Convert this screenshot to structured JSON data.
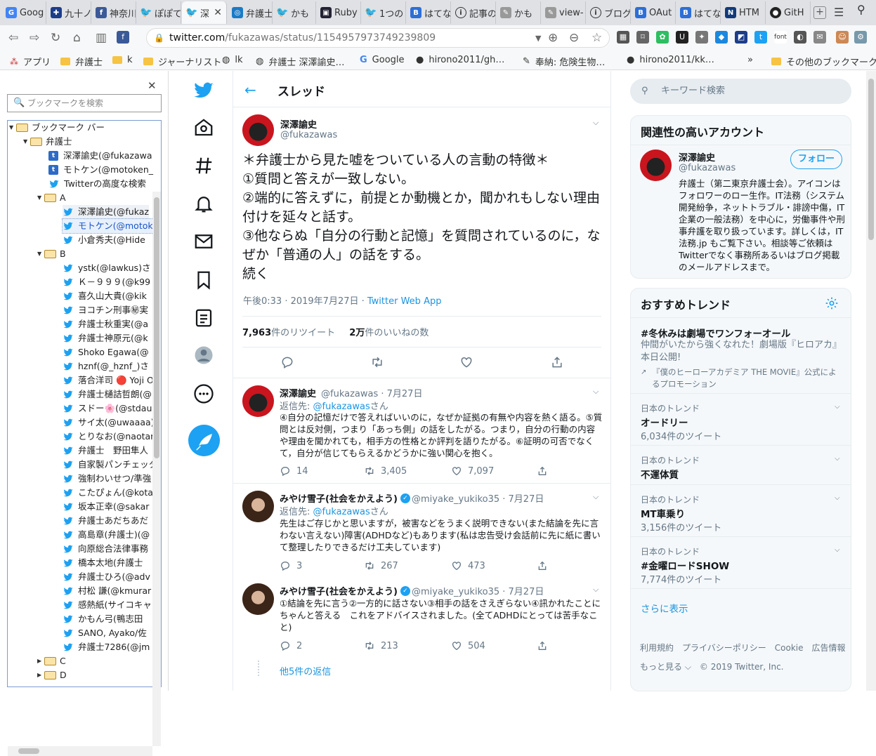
{
  "browser": {
    "tabs": [
      "Goog",
      "九十ノ",
      "神奈川",
      "ぽぽて",
      "深",
      "弁護士",
      "かも",
      "Ruby",
      "1つの",
      "はてな",
      "記事の",
      "かも",
      "view-",
      "ブログ",
      "OAut",
      "はてな",
      "HTM",
      "GitH"
    ],
    "url_host": "twitter.com",
    "url_path": "/fukazawas/status/1154957973749239809"
  },
  "bookmarks_bar": [
    "アプリ",
    "弁護士",
    "k",
    "ジャーナリスト",
    "lk",
    "弁護士 深澤諭史…",
    "Google",
    "hirono2011/gh…",
    "奉納: 危険生物…",
    "hirono2011/kk…",
    "その他のブックマーク"
  ],
  "sidebar": {
    "search_placeholder": "ブックマークを検索",
    "tree": {
      "root": "ブックマーク バー",
      "f1": "弁護士",
      "i1": "深澤諭史(@fukazawa",
      "i2": "モトケン(@motoken_",
      "i3": "Twitterの高度な検索",
      "fA": "A",
      "a1": "深澤諭史(@fukaz",
      "a2": "モトケン(@motok",
      "a3": "小倉秀夫(@Hide",
      "fB": "B",
      "b": [
        "ystk(@lawkus)さ",
        "Ｋ－９９９(@k99",
        "喜久山大貴(@kik",
        "ヨコチン刑事㊙実",
        "弁護士秋重実(@a",
        "弁護士神原元(@k",
        "Shoko Egawa(@",
        "hznf(@_hznf_)さ",
        "落合洋司 🔴 Yoji O",
        "弁護士樋詰哲朗(@",
        "スドー🌸(@stdau",
        "サイ太(@uwaaaa)",
        "とりなお(@naotar",
        "弁護士　野田隼人",
        "自家製パンチェッタ",
        "強制わいせつ/準強",
        "こたぴょん(@kota",
        "坂本正幸(@sakar",
        "弁護士あだちあだ",
        "高島章(弁護士)(@",
        "向原総合法律事務",
        "橋本太地(弁護士",
        "弁護士ひろ(@adv",
        "村松 謙(@kmurar",
        "感熱紙(サイコキャ",
        "かもん弓(鴨志田",
        "SANO, Ayako/佐",
        "弁護士7286(@jm"
      ],
      "fC": "C",
      "fD": "D"
    }
  },
  "main": {
    "header": "スレッド",
    "tweet": {
      "name": "深澤諭史",
      "handle": "@fukazawas",
      "lines": [
        "＊弁護士から見た嘘をついている人の言動の特徴＊",
        "①質問と答えが一致しない。",
        "②端的に答えずに，前提とか動機とか，聞かれもしない理由",
        "付けを延々と話す。",
        "③他ならぬ「自分の行動と記憶」を質問されているのに，な",
        "ぜか「普通の人」の話をする。",
        "続く"
      ],
      "time": "午後0:33 · 2019年7月27日 · ",
      "app": "Twitter Web App",
      "rt_num": "7,963",
      "rt_label": "件のリツイート",
      "like_num": "2万",
      "like_label": "件のいいねの数"
    },
    "replies": [
      {
        "name": "深澤諭史",
        "meta": "@fukazawas · 7月27日",
        "to_prefix": "返信先: ",
        "to": "@fukazawas",
        "to_suffix": "さん",
        "text": "④自分の記憶だけで答えればいいのに，なぜか証拠の有無や内容を熱く語る。⑤質問とは反対側，つまり「あっち側」の話をしたがる。つまり，自分の行動の内容や理由を聞かれても，相手方の性格とか評判を語りたがる。⑥証明の可否でなくて，自分が信じてもらえるかどうかに強い関心を抱く。",
        "replies": "14",
        "retweets": "3,405",
        "likes": "7,097"
      },
      {
        "name": "みやけ雪子(社会をかえよう)",
        "meta": "@miyake_yukiko35 · 7月27日",
        "to_prefix": "返信先: ",
        "to": "@fukazawas",
        "to_suffix": "さん",
        "text": "先生はご存じかと思いますが，被害などをうまく説明できない(また結論を先に言わない言えない)障害(ADHDなど)もあります(私は忠告受け会話前に先に紙に書いて整理したりできるだけ工夫しています)",
        "replies": "3",
        "retweets": "267",
        "likes": "473"
      },
      {
        "name": "みやけ雪子(社会をかえよう)",
        "meta": "@miyake_yukiko35 · 7月27日",
        "text": "①結論を先に言う②一方的に話さない③相手の話をさえぎらない④訊かれたことにちゃんと答える　これをアドバイスされました。(全てADHDにとっては苦手なこと)",
        "replies": "2",
        "retweets": "213",
        "likes": "504"
      }
    ],
    "more_replies": "他5件の返信"
  },
  "right": {
    "search_placeholder": "キーワード検索",
    "related_title": "関連性の高いアカウント",
    "account": {
      "name": "深澤諭史",
      "handle": "@fukazawas",
      "follow": "フォロー",
      "bio": "弁護士（第二東京弁護士会）。アイコンはフォロワーのロー生作。IT法務（システム開発紛争，ネットトラブル・誹謗中傷，IT企業の一般法務）を中心に，労働事件や刑事弁護を取り扱っています。詳しくは，IT法務.jp もご覧下さい。相談等ご依頼はTwitterでなく事務所あるいはブログ掲載のメールアドレスまで。"
    },
    "trends_title": "おすすめトレンド",
    "promo": {
      "name": "#冬休みは劇場でワンフォーオール",
      "desc": "仲間がいたから強くなれた！劇場版『ヒロアカ』本日公開!",
      "by": "『僕のヒーローアカデミア THE MOVIE』公式によるプロモーション"
    },
    "trends": [
      {
        "cat": "日本のトレンド",
        "name": "オードリー",
        "count": "6,034件のツイート"
      },
      {
        "cat": "日本のトレンド",
        "name": "不運体質",
        "count": ""
      },
      {
        "cat": "日本のトレンド",
        "name": "MT車乗り",
        "count": "3,156件のツイート"
      },
      {
        "cat": "日本のトレンド",
        "name": "#金曜ロードSHOW",
        "count": "7,774件のツイート"
      }
    ],
    "show_more": "さらに表示",
    "footer1": "利用規約　プライバシーポリシー　Cookie　広告情報",
    "footer2": "もっと見る ⌵　© 2019 Twitter, Inc."
  },
  "colors": {
    "accent": "#1da1f2",
    "link": "#1b95e0",
    "muted": "#657786"
  }
}
